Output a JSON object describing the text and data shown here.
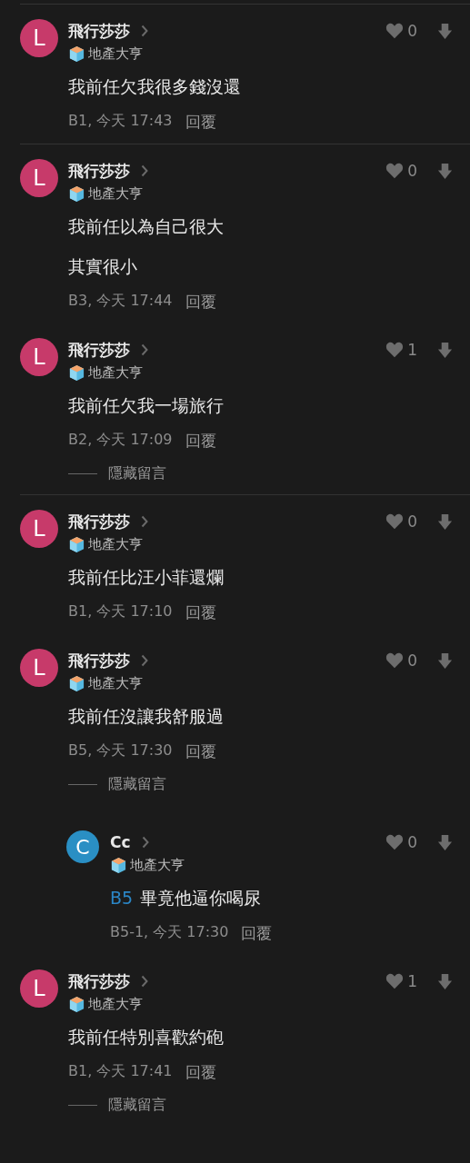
{
  "comments": [
    {
      "avatar": "L",
      "color": "#c73a6a",
      "name": "飛行莎莎",
      "badge": "地產大亨",
      "lines": [
        "我前任欠我很多錢沒還"
      ],
      "meta": "B1, 今天 17:43",
      "reply": "回覆",
      "likes": "0",
      "divider": true
    },
    {
      "avatar": "L",
      "color": "#c73a6a",
      "name": "飛行莎莎",
      "badge": "地產大亨",
      "lines": [
        "我前任以為自己很大",
        "其實很小"
      ],
      "meta": "B3, 今天 17:44",
      "reply": "回覆",
      "likes": "0",
      "divider": false
    },
    {
      "avatar": "L",
      "color": "#c73a6a",
      "name": "飛行莎莎",
      "badge": "地產大亨",
      "lines": [
        "我前任欠我一場旅行"
      ],
      "meta": "B2, 今天 17:09",
      "reply": "回覆",
      "likes": "1",
      "hide": "隱藏留言",
      "divider": true
    },
    {
      "avatar": "L",
      "color": "#c73a6a",
      "name": "飛行莎莎",
      "badge": "地產大亨",
      "lines": [
        "我前任比汪小菲還爛"
      ],
      "meta": "B1, 今天 17:10",
      "reply": "回覆",
      "likes": "0",
      "divider": false
    },
    {
      "avatar": "L",
      "color": "#c73a6a",
      "name": "飛行莎莎",
      "badge": "地產大亨",
      "lines": [
        "我前任沒讓我舒服過"
      ],
      "meta": "B5, 今天 17:30",
      "reply": "回覆",
      "likes": "0",
      "hide": "隱藏留言",
      "divider": false,
      "replies": [
        {
          "avatar": "C",
          "color": "#2a8fc4",
          "name": "Cc",
          "badge": "地產大亨",
          "mention": "B5",
          "text": "畢竟他逼你喝尿",
          "meta": "B5-1, 今天 17:30",
          "reply": "回覆",
          "likes": "0"
        }
      ]
    },
    {
      "avatar": "L",
      "color": "#c73a6a",
      "name": "飛行莎莎",
      "badge": "地產大亨",
      "lines": [
        "我前任特別喜歡約砲"
      ],
      "meta": "B1, 今天 17:41",
      "reply": "回覆",
      "likes": "1",
      "hide": "隱藏留言",
      "divider": false
    }
  ]
}
